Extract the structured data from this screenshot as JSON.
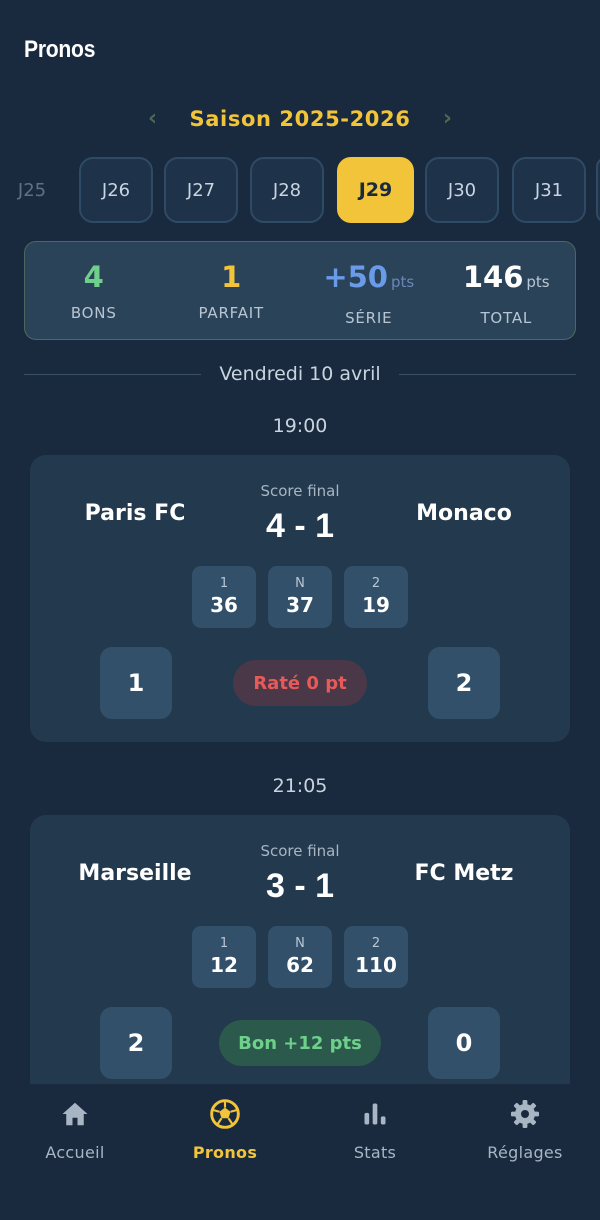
{
  "header": {
    "title": "Pronos"
  },
  "season": {
    "label": "Saison 2025-2026",
    "prev_icon": "chevron-left-icon",
    "next_icon": "chevron-right-icon"
  },
  "rounds": [
    {
      "label": "J25",
      "state": "partial"
    },
    {
      "label": "J26",
      "state": "normal"
    },
    {
      "label": "J27",
      "state": "normal"
    },
    {
      "label": "J28",
      "state": "normal"
    },
    {
      "label": "J29",
      "state": "active"
    },
    {
      "label": "J30",
      "state": "normal"
    },
    {
      "label": "J31",
      "state": "normal"
    }
  ],
  "summary": {
    "bons": {
      "value": "4",
      "label": "BONS"
    },
    "parfait": {
      "value": "1",
      "label": "PARFAIT"
    },
    "serie": {
      "value": "+50",
      "unit": "pts",
      "label": "SÉRIE"
    },
    "total": {
      "value": "146",
      "unit": "pts",
      "label": "TOTAL"
    }
  },
  "day": {
    "label": "Vendredi 10 avril"
  },
  "matches": [
    {
      "time": "19:00",
      "home": "Paris FC",
      "away": "Monaco",
      "status_label": "Score final",
      "score": "4 - 1",
      "odds": [
        {
          "key": "1",
          "value": "36"
        },
        {
          "key": "N",
          "value": "37"
        },
        {
          "key": "2",
          "value": "19"
        }
      ],
      "pick_home": "1",
      "pick_away": "2",
      "result": "Raté 0 pt"
    },
    {
      "time": "21:05",
      "home": "Marseille",
      "away": "FC Metz",
      "status_label": "Score final",
      "score": "3 - 1",
      "odds": [
        {
          "key": "1",
          "value": "12"
        },
        {
          "key": "N",
          "value": "62"
        },
        {
          "key": "2",
          "value": "110"
        }
      ],
      "pick_home": "2",
      "pick_away": "0",
      "result": "Bon +12 pts"
    }
  ],
  "tabbar": [
    {
      "label": "Accueil",
      "icon": "home-icon",
      "active": false
    },
    {
      "label": "Pronos",
      "icon": "soccer-ball-icon",
      "active": true
    },
    {
      "label": "Stats",
      "icon": "bar-chart-icon",
      "active": false
    },
    {
      "label": "Réglages",
      "icon": "gear-icon",
      "active": false
    }
  ],
  "colors": {
    "background": "#1a2a3e",
    "accent": "#f2c43a",
    "success": "#6fd08c",
    "error": "#e85a5a",
    "info": "#6a9be8"
  }
}
